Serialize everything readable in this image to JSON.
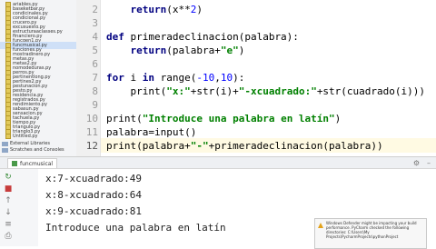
{
  "project": {
    "files": [
      "ariables.py",
      "baseketbar.py",
      "condicinales.py",
      "condicional.py",
      "crucero.py",
      "excusuesto.py",
      "estructuraaclasses.py",
      "financiero.py",
      "funcgen1.py",
      "funcmusical.py",
      "funciones.py",
      "mostradinero.py",
      "metas.py",
      "metas2.py",
      "nomodeduras.py",
      "perros.py",
      "pertinentlong.py",
      "pertines2.py",
      "pestunacion.py",
      "pesto.py",
      "residencia.py",
      "registrados.py",
      "rendimiento.py",
      "sabasun.py",
      "sensacion.py",
      "tachuela.py",
      "tiempo.py",
      "triangulo.py",
      "trianglo3.py",
      "Untitled.py"
    ],
    "selected_file": "funcmusical.py",
    "folders": [
      "External Libraries",
      "Scratches and Consoles"
    ]
  },
  "editor": {
    "line_numbers": [
      "2",
      "3",
      "4",
      "5",
      "6",
      "7",
      "8",
      "9",
      "10",
      "11",
      "12"
    ],
    "current_line": "12"
  },
  "run": {
    "tab_label": "funcmusical",
    "output": [
      "x:7-xcuadrado:49",
      "x:8-xcuadrado:64",
      "x:9-xcuadrado:81",
      "Introduce una palabra en latín"
    ]
  },
  "notification": {
    "text": "Windows Defender might be impacting your build performance. PyCharm checked the following directories: C:\\Users\\My Projects\\PycharmProjects\\pythonProject"
  }
}
